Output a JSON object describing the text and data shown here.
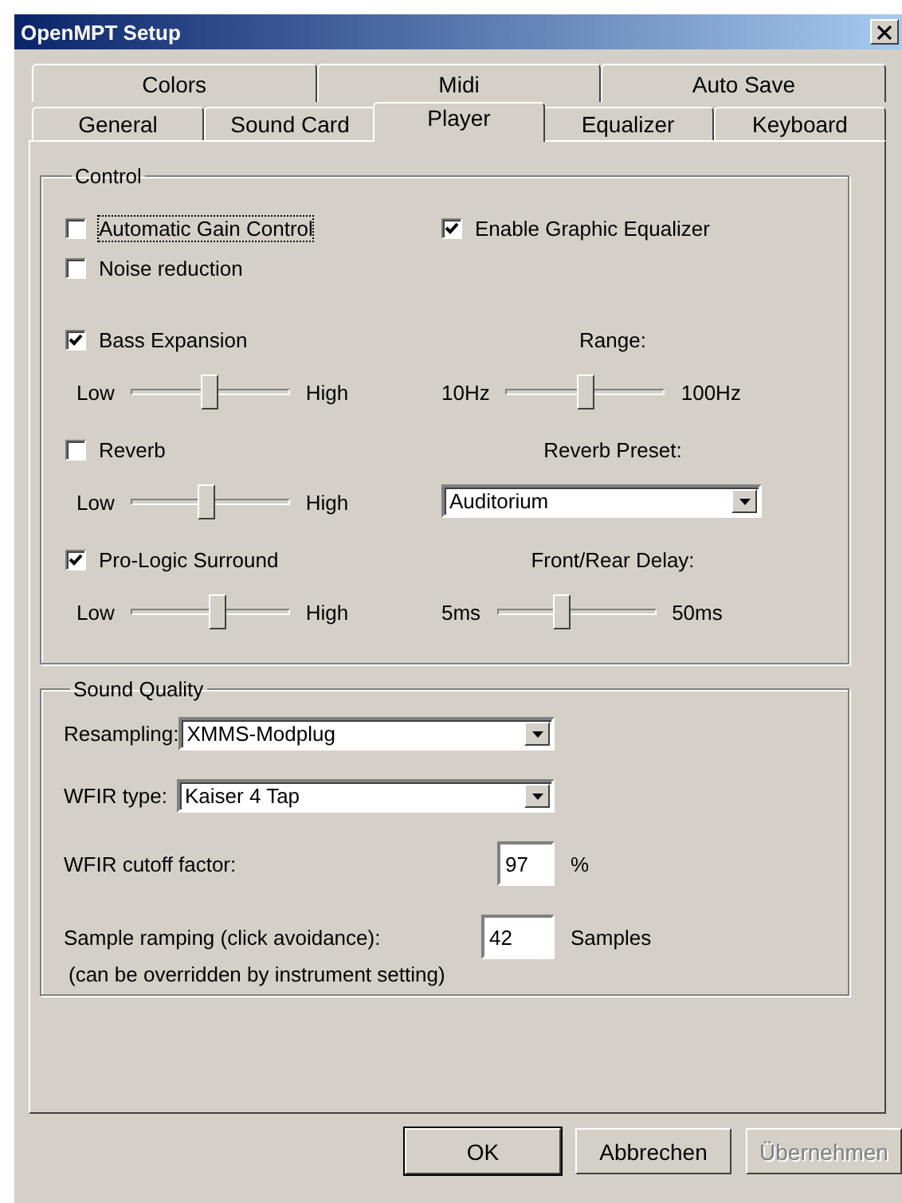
{
  "window": {
    "title": "OpenMPT Setup"
  },
  "tab_rows": [
    [
      {
        "label": "Colors",
        "selected": false
      },
      {
        "label": "Midi",
        "selected": false
      },
      {
        "label": "Auto Save",
        "selected": false
      }
    ],
    [
      {
        "label": "General",
        "selected": false
      },
      {
        "label": "Sound Card",
        "selected": false
      },
      {
        "label": "Player",
        "selected": true
      },
      {
        "label": "Equalizer",
        "selected": false
      },
      {
        "label": "Keyboard",
        "selected": false
      }
    ]
  ],
  "control": {
    "title": "Control",
    "options": [
      {
        "label": "Automatic Gain Control",
        "checked": false,
        "focused": true
      },
      {
        "label": "Enable Graphic Equalizer",
        "checked": true,
        "focused": false
      },
      {
        "label": "Noise reduction",
        "checked": false,
        "focused": false
      }
    ],
    "effects": [
      {
        "label": "Bass Expansion",
        "checked": true,
        "low": "Low",
        "high": "High",
        "level": 0.5,
        "setting": {
          "kind": "slider",
          "label": "Range:",
          "low": "10Hz",
          "high": "100Hz",
          "level": 0.5
        }
      },
      {
        "label": "Reverb",
        "checked": false,
        "low": "Low",
        "high": "High",
        "level": 0.47,
        "setting": {
          "kind": "dropdown",
          "label": "Reverb Preset:",
          "value": "Auditorium"
        }
      },
      {
        "label": "Pro-Logic Surround",
        "checked": true,
        "low": "Low",
        "high": "High",
        "level": 0.55,
        "setting": {
          "kind": "slider",
          "label": "Front/Rear Delay:",
          "low": "5ms",
          "high": "50ms",
          "level": 0.4
        }
      }
    ]
  },
  "sound_quality": {
    "title": "Sound Quality",
    "rows": [
      {
        "kind": "dropdown",
        "label": "Resampling:",
        "value": "XMMS-Modplug"
      },
      {
        "kind": "dropdown",
        "label": "WFIR type:",
        "value": "Kaiser 4 Tap"
      },
      {
        "kind": "number",
        "label": "WFIR cutoff factor:",
        "value": "97",
        "unit": "%"
      },
      {
        "kind": "number",
        "label": "Sample ramping (click avoidance):",
        "value": "42",
        "unit": "Samples",
        "note": "(can be overridden by instrument setting)"
      }
    ]
  },
  "buttons": [
    {
      "label": "OK",
      "default": true,
      "disabled": false
    },
    {
      "label": "Abbrechen",
      "default": false,
      "disabled": false
    },
    {
      "label": "Übernehmen",
      "default": false,
      "disabled": true
    }
  ]
}
